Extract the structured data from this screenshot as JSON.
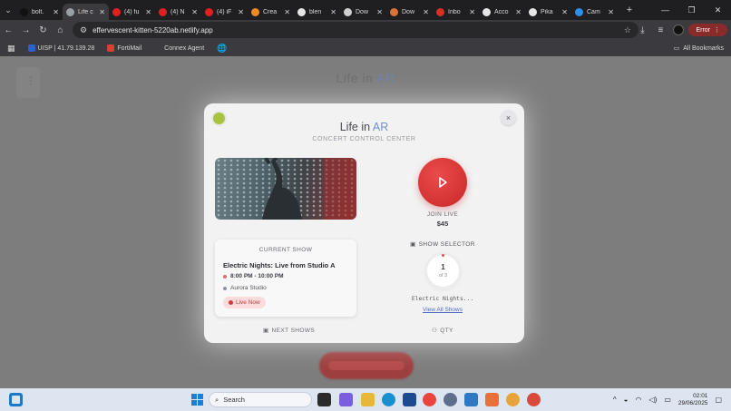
{
  "browser": {
    "tabs": [
      {
        "label": "bolt.",
        "favicon_color": "#111111",
        "active": false
      },
      {
        "label": "Life c",
        "favicon_color": "#9aa0a6",
        "active": true
      },
      {
        "label": "(4) fu",
        "favicon_color": "#e02020",
        "active": false
      },
      {
        "label": "(4) N",
        "favicon_color": "#e02020",
        "active": false
      },
      {
        "label": "(4) iF",
        "favicon_color": "#e02020",
        "active": false
      },
      {
        "label": "Crea",
        "favicon_color": "#f08a24",
        "active": false
      },
      {
        "label": "blen",
        "favicon_color": "#e6e6e6",
        "active": false
      },
      {
        "label": "Dow",
        "favicon_color": "#cfcfcf",
        "active": false
      },
      {
        "label": "Dow",
        "favicon_color": "#d9733a",
        "active": false
      },
      {
        "label": "Inbo",
        "favicon_color": "#d93025",
        "active": false
      },
      {
        "label": "Acco",
        "favicon_color": "#e6e6e6",
        "active": false
      },
      {
        "label": "Pika",
        "favicon_color": "#e6e6e6",
        "active": false
      },
      {
        "label": "Cam",
        "favicon_color": "#2f8fe8",
        "active": false
      }
    ],
    "url": "effervescent-kitten-5220ab.netlify.app",
    "error_label": "Error",
    "bookmarks": [
      {
        "label": "UISP | 41.79.139.28",
        "color": "#2b62c9"
      },
      {
        "label": "FortiMail",
        "color": "#d8412f"
      },
      {
        "label": "Connex Agent",
        "color": "#3b3b3f"
      },
      {
        "label": "",
        "color": "#cfcfcf"
      }
    ],
    "all_bookmarks_label": "All Bookmarks"
  },
  "background_page": {
    "title_prefix": "Life in ",
    "title_accent": "AR"
  },
  "modal": {
    "title_prefix": "Life in ",
    "title_accent": "AR",
    "subtitle": "CONCERT CONTROL CENTER",
    "close_icon": "×",
    "current_show": {
      "heading": "CURRENT SHOW",
      "title": "Electric Nights: Live from Studio A",
      "time": "8:00 PM - 10:00 PM",
      "venue": "Aurora Studio",
      "status": "Live Now"
    },
    "join": {
      "label": "JOIN LIVE",
      "price": "$45"
    },
    "selector": {
      "label": "SHOW SELECTOR",
      "current": "1",
      "total_label": "of 3",
      "show_name": "Electric Nights...",
      "view_all": "View All Shows"
    },
    "footer": {
      "next_shows": "NEXT SHOWS",
      "qty": "QTY"
    }
  },
  "taskbar": {
    "search_placeholder": "Search",
    "time": "02:01",
    "date": "29/06/2025"
  }
}
